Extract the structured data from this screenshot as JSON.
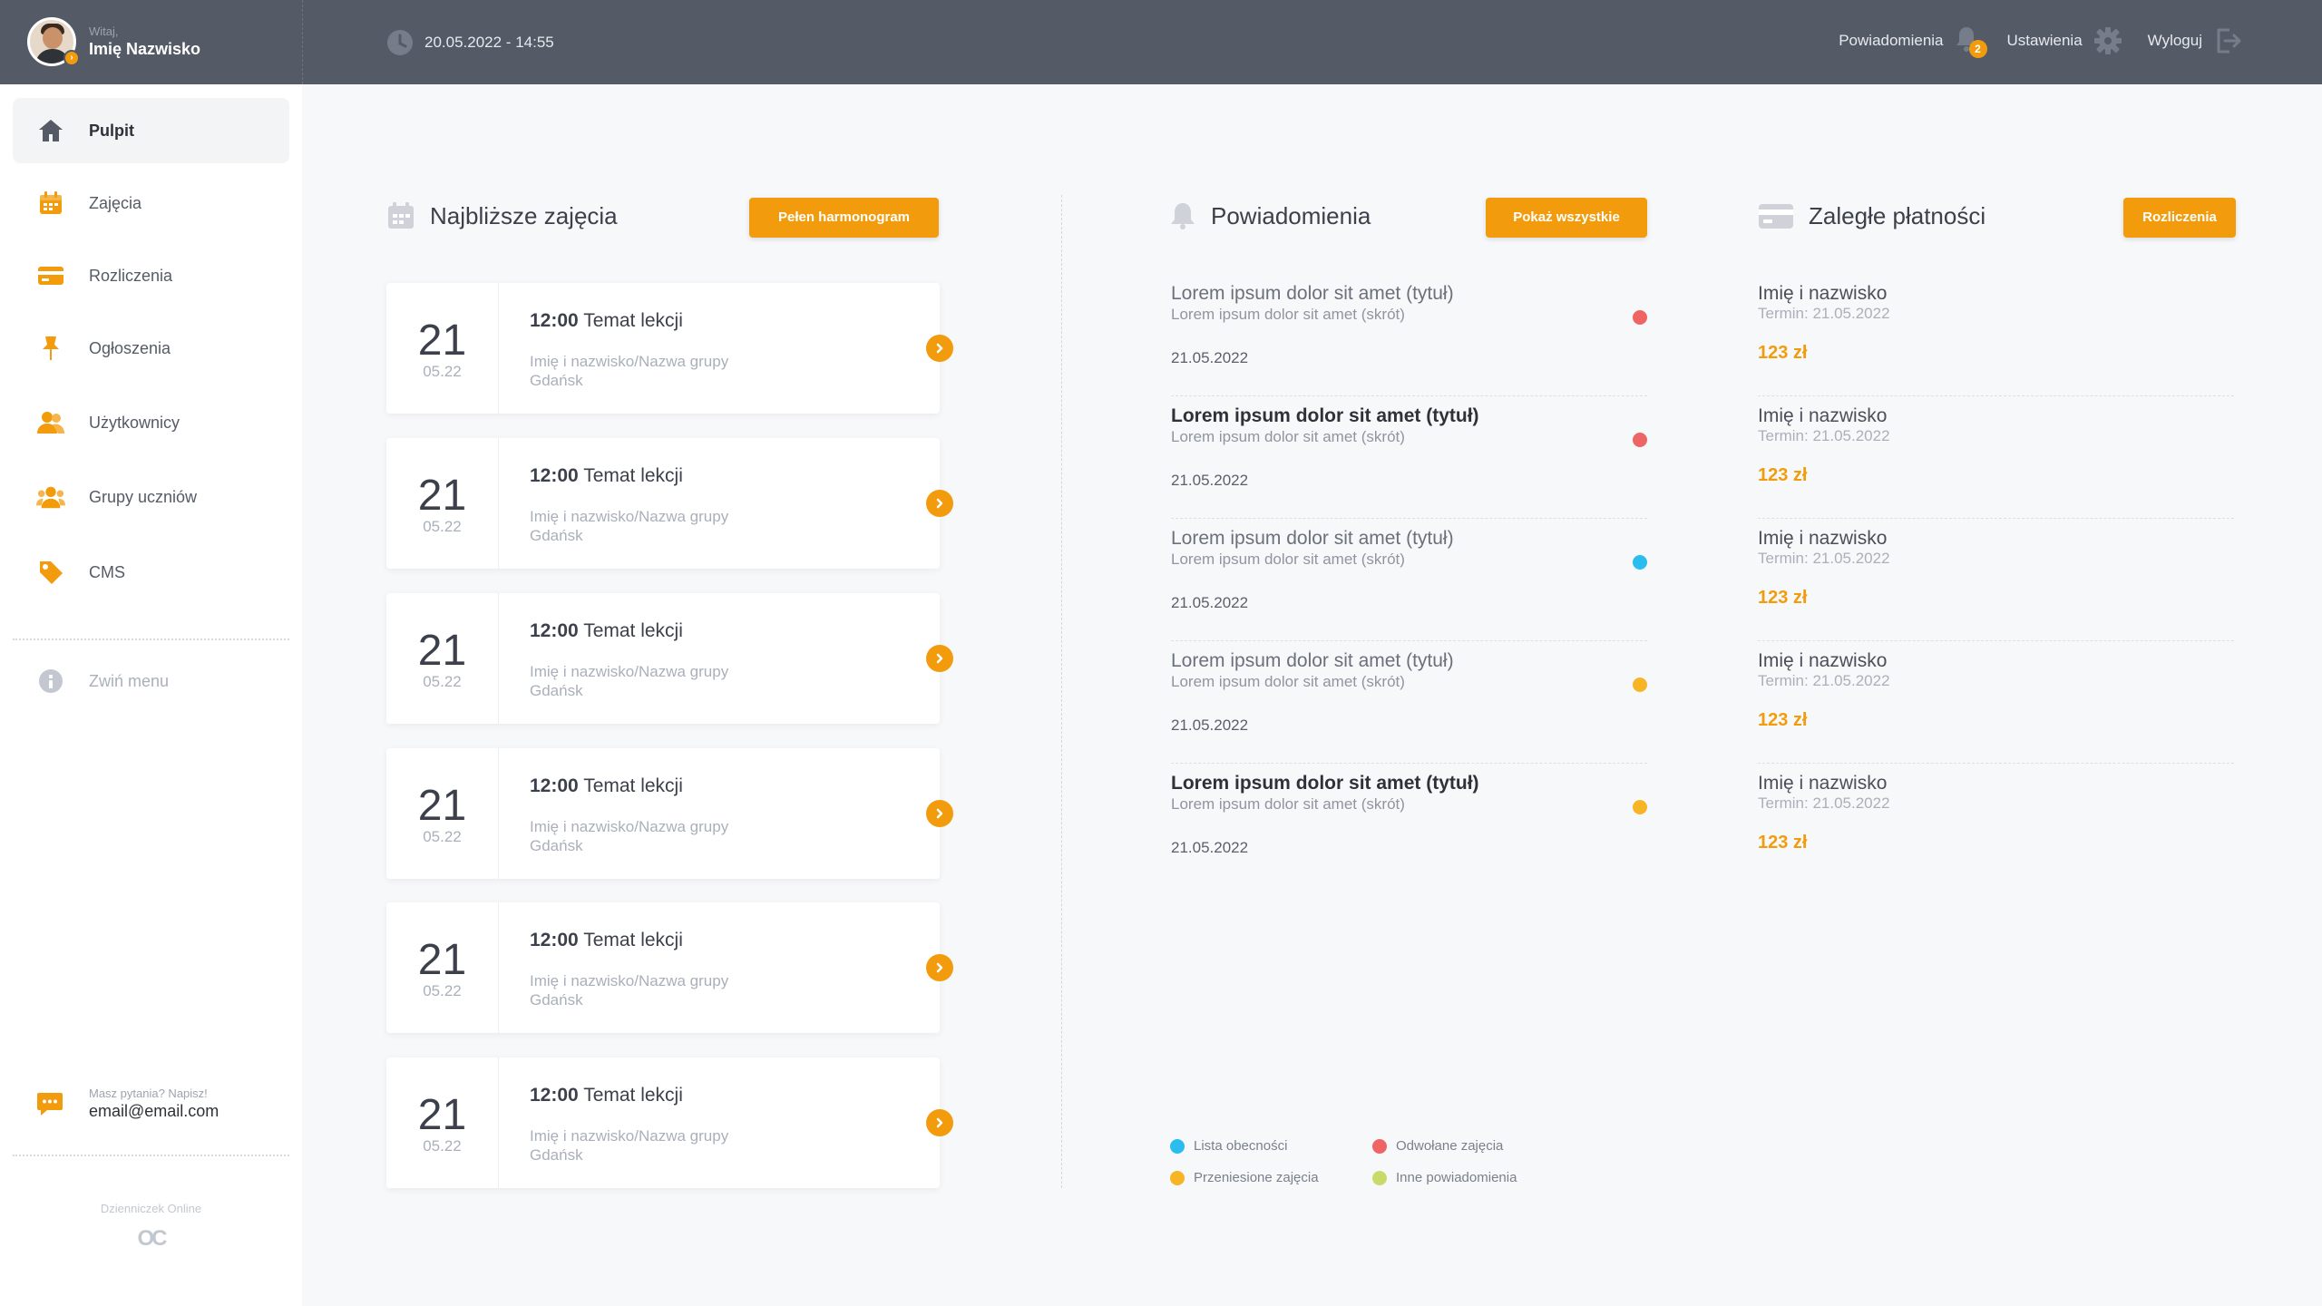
{
  "header": {
    "welcome": "Witaj,",
    "username": "Imię Nazwisko",
    "datetime": "20.05.2022 - 14:55",
    "notifications_label": "Powiadomienia",
    "notifications_count": "2",
    "settings_label": "Ustawienia",
    "logout_label": "Wyloguj"
  },
  "sidebar": {
    "items": [
      {
        "label": "Pulpit",
        "icon": "home-icon"
      },
      {
        "label": "Zajęcia",
        "icon": "calendar-icon"
      },
      {
        "label": "Rozliczenia",
        "icon": "card-icon"
      },
      {
        "label": "Ogłoszenia",
        "icon": "pin-icon"
      },
      {
        "label": "Użytkownicy",
        "icon": "users-icon"
      },
      {
        "label": "Grupy uczniów",
        "icon": "group-icon"
      },
      {
        "label": "CMS",
        "icon": "tag-icon"
      }
    ],
    "collapse_label": "Zwiń menu",
    "contact_question": "Masz pytania? Napisz!",
    "contact_email": "email@email.com",
    "brand_name": "Dzienniczek Online",
    "brand_logo": "OC"
  },
  "lessons": {
    "title": "Najbliższe zajęcia",
    "button": "Pełen harmonogram",
    "items": [
      {
        "day": "21",
        "month": "05.22",
        "time": "12:00",
        "topic": "Temat lekcji",
        "who": "Imię i nazwisko/Nazwa grupy",
        "city": "Gdańsk"
      },
      {
        "day": "21",
        "month": "05.22",
        "time": "12:00",
        "topic": "Temat lekcji",
        "who": "Imię i nazwisko/Nazwa grupy",
        "city": "Gdańsk"
      },
      {
        "day": "21",
        "month": "05.22",
        "time": "12:00",
        "topic": "Temat lekcji",
        "who": "Imię i nazwisko/Nazwa grupy",
        "city": "Gdańsk"
      },
      {
        "day": "21",
        "month": "05.22",
        "time": "12:00",
        "topic": "Temat lekcji",
        "who": "Imię i nazwisko/Nazwa grupy",
        "city": "Gdańsk"
      },
      {
        "day": "21",
        "month": "05.22",
        "time": "12:00",
        "topic": "Temat lekcji",
        "who": "Imię i nazwisko/Nazwa grupy",
        "city": "Gdańsk"
      },
      {
        "day": "21",
        "month": "05.22",
        "time": "12:00",
        "topic": "Temat lekcji",
        "who": "Imię i nazwisko/Nazwa grupy",
        "city": "Gdańsk"
      }
    ]
  },
  "notifications": {
    "title": "Powiadomienia",
    "button": "Pokaż wszystkie",
    "items": [
      {
        "title": "Lorem ipsum dolor sit amet (tytuł)",
        "summary": "Lorem ipsum dolor sit amet (skrót)",
        "date": "21.05.2022",
        "color": "#ef6464",
        "unread": false
      },
      {
        "title": "Lorem ipsum dolor sit amet (tytuł)",
        "summary": "Lorem ipsum dolor sit amet (skrót)",
        "date": "21.05.2022",
        "color": "#ef6464",
        "unread": true
      },
      {
        "title": "Lorem ipsum dolor sit amet (tytuł)",
        "summary": "Lorem ipsum dolor sit amet (skrót)",
        "date": "21.05.2022",
        "color": "#2bbcf0",
        "unread": false
      },
      {
        "title": "Lorem ipsum dolor sit amet (tytuł)",
        "summary": "Lorem ipsum dolor sit amet (skrót)",
        "date": "21.05.2022",
        "color": "#f7b526",
        "unread": false
      },
      {
        "title": "Lorem ipsum dolor sit amet (tytuł)",
        "summary": "Lorem ipsum dolor sit amet (skrót)",
        "date": "21.05.2022",
        "color": "#f7b526",
        "unread": true
      }
    ],
    "legend": [
      {
        "label": "Lista obecności",
        "color": "#2bbcf0"
      },
      {
        "label": "Odwołane zajęcia",
        "color": "#ef6464"
      },
      {
        "label": "Przeniesione zajęcia",
        "color": "#f7b526"
      },
      {
        "label": "Inne powiadomienia",
        "color": "#c9da6b"
      }
    ]
  },
  "payments": {
    "title": "Zaległe płatności",
    "button": "Rozliczenia",
    "items": [
      {
        "name": "Imię i nazwisko",
        "term": "Termin: 21.05.2022",
        "amount": "123 zł"
      },
      {
        "name": "Imię i nazwisko",
        "term": "Termin: 21.05.2022",
        "amount": "123 zł"
      },
      {
        "name": "Imię i nazwisko",
        "term": "Termin: 21.05.2022",
        "amount": "123 zł"
      },
      {
        "name": "Imię i nazwisko",
        "term": "Termin: 21.05.2022",
        "amount": "123 zł"
      },
      {
        "name": "Imię i nazwisko",
        "term": "Termin: 21.05.2022",
        "amount": "123 zł"
      }
    ]
  },
  "colors": {
    "accent": "#f29c0d",
    "topbar": "#545a66"
  }
}
